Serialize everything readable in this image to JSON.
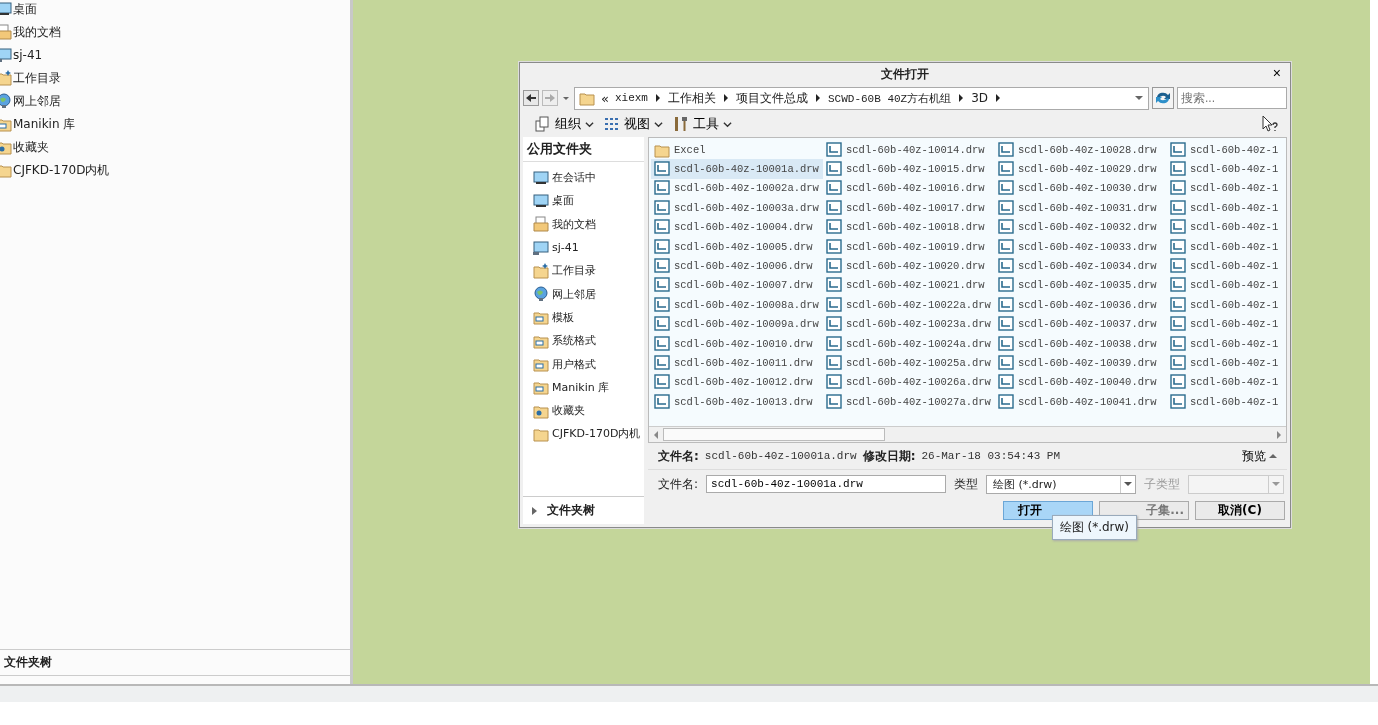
{
  "left_panel": {
    "items": [
      {
        "label": "桌面",
        "kind": "monitor"
      },
      {
        "label": "我的文档",
        "kind": "documents"
      },
      {
        "label": "sj-41",
        "kind": "computer"
      },
      {
        "label": "工作目录",
        "kind": "workdir"
      },
      {
        "label": "网上邻居",
        "kind": "network"
      },
      {
        "label": "Manikin 库",
        "kind": "library"
      },
      {
        "label": "收藏夹",
        "kind": "favorites"
      },
      {
        "label": "CJFKD-170D内机",
        "kind": "folder"
      }
    ],
    "footer": "文件夹树"
  },
  "dialog": {
    "title": "文件打开",
    "close": "×",
    "address": {
      "overflow": "«",
      "crumbs": [
        "xiexm",
        "工作相关",
        "项目文件总成",
        "SCWD-60B 40Z方右机组",
        "3D"
      ]
    },
    "search": {
      "placeholder": "搜索..."
    },
    "toolbar": [
      {
        "label": "组织",
        "kind": "organize"
      },
      {
        "label": "视图",
        "kind": "view"
      },
      {
        "label": "工具",
        "kind": "tools"
      }
    ],
    "sidebar": {
      "header": "公用文件夹",
      "items": [
        {
          "label": "在会话中",
          "kind": "monitor"
        },
        {
          "label": "桌面",
          "kind": "monitor"
        },
        {
          "label": "我的文档",
          "kind": "documents"
        },
        {
          "label": "sj-41",
          "kind": "computer"
        },
        {
          "label": "工作目录",
          "kind": "workdir"
        },
        {
          "label": "网上邻居",
          "kind": "network"
        },
        {
          "label": "模板",
          "kind": "library"
        },
        {
          "label": "系统格式",
          "kind": "library"
        },
        {
          "label": "用户格式",
          "kind": "library"
        },
        {
          "label": "Manikin 库",
          "kind": "library"
        },
        {
          "label": "收藏夹",
          "kind": "favorites"
        },
        {
          "label": "CJFKD-170D内机",
          "kind": "folder"
        }
      ],
      "footer": "文件夹树"
    },
    "files": [
      {
        "name": "Excel",
        "kind": "folder",
        "selected": false
      },
      {
        "name": "scdl-60b-40z-10001a.drw",
        "kind": "drawing",
        "selected": true
      },
      {
        "name": "scdl-60b-40z-10002a.drw",
        "kind": "drawing",
        "selected": false
      },
      {
        "name": "scdl-60b-40z-10003a.drw",
        "kind": "drawing",
        "selected": false
      },
      {
        "name": "scdl-60b-40z-10004.drw",
        "kind": "drawing",
        "selected": false
      },
      {
        "name": "scdl-60b-40z-10005.drw",
        "kind": "drawing",
        "selected": false
      },
      {
        "name": "scdl-60b-40z-10006.drw",
        "kind": "drawing",
        "selected": false
      },
      {
        "name": "scdl-60b-40z-10007.drw",
        "kind": "drawing",
        "selected": false
      },
      {
        "name": "scdl-60b-40z-10008a.drw",
        "kind": "drawing",
        "selected": false
      },
      {
        "name": "scdl-60b-40z-10009a.drw",
        "kind": "drawing",
        "selected": false
      },
      {
        "name": "scdl-60b-40z-10010.drw",
        "kind": "drawing",
        "selected": false
      },
      {
        "name": "scdl-60b-40z-10011.drw",
        "kind": "drawing",
        "selected": false
      },
      {
        "name": "scdl-60b-40z-10012.drw",
        "kind": "drawing",
        "selected": false
      },
      {
        "name": "scdl-60b-40z-10013.drw",
        "kind": "drawing",
        "selected": false
      },
      {
        "name": "scdl-60b-40z-10014.drw",
        "kind": "drawing",
        "selected": false
      },
      {
        "name": "scdl-60b-40z-10015.drw",
        "kind": "drawing",
        "selected": false
      },
      {
        "name": "scdl-60b-40z-10016.drw",
        "kind": "drawing",
        "selected": false
      },
      {
        "name": "scdl-60b-40z-10017.drw",
        "kind": "drawing",
        "selected": false
      },
      {
        "name": "scdl-60b-40z-10018.drw",
        "kind": "drawing",
        "selected": false
      },
      {
        "name": "scdl-60b-40z-10019.drw",
        "kind": "drawing",
        "selected": false
      },
      {
        "name": "scdl-60b-40z-10020.drw",
        "kind": "drawing",
        "selected": false
      },
      {
        "name": "scdl-60b-40z-10021.drw",
        "kind": "drawing",
        "selected": false
      },
      {
        "name": "scdl-60b-40z-10022a.drw",
        "kind": "drawing",
        "selected": false
      },
      {
        "name": "scdl-60b-40z-10023a.drw",
        "kind": "drawing",
        "selected": false
      },
      {
        "name": "scdl-60b-40z-10024a.drw",
        "kind": "drawing",
        "selected": false
      },
      {
        "name": "scdl-60b-40z-10025a.drw",
        "kind": "drawing",
        "selected": false
      },
      {
        "name": "scdl-60b-40z-10026a.drw",
        "kind": "drawing",
        "selected": false
      },
      {
        "name": "scdl-60b-40z-10027a.drw",
        "kind": "drawing",
        "selected": false
      },
      {
        "name": "scdl-60b-40z-10028.drw",
        "kind": "drawing",
        "selected": false
      },
      {
        "name": "scdl-60b-40z-10029.drw",
        "kind": "drawing",
        "selected": false
      },
      {
        "name": "scdl-60b-40z-10030.drw",
        "kind": "drawing",
        "selected": false
      },
      {
        "name": "scdl-60b-40z-10031.drw",
        "kind": "drawing",
        "selected": false
      },
      {
        "name": "scdl-60b-40z-10032.drw",
        "kind": "drawing",
        "selected": false
      },
      {
        "name": "scdl-60b-40z-10033.drw",
        "kind": "drawing",
        "selected": false
      },
      {
        "name": "scdl-60b-40z-10034.drw",
        "kind": "drawing",
        "selected": false
      },
      {
        "name": "scdl-60b-40z-10035.drw",
        "kind": "drawing",
        "selected": false
      },
      {
        "name": "scdl-60b-40z-10036.drw",
        "kind": "drawing",
        "selected": false
      },
      {
        "name": "scdl-60b-40z-10037.drw",
        "kind": "drawing",
        "selected": false
      },
      {
        "name": "scdl-60b-40z-10038.drw",
        "kind": "drawing",
        "selected": false
      },
      {
        "name": "scdl-60b-40z-10039.drw",
        "kind": "drawing",
        "selected": false
      },
      {
        "name": "scdl-60b-40z-10040.drw",
        "kind": "drawing",
        "selected": false
      },
      {
        "name": "scdl-60b-40z-10041.drw",
        "kind": "drawing",
        "selected": false
      },
      {
        "name": "scdl-60b-40z-1",
        "kind": "drawing",
        "selected": false
      },
      {
        "name": "scdl-60b-40z-1",
        "kind": "drawing",
        "selected": false
      },
      {
        "name": "scdl-60b-40z-1",
        "kind": "drawing",
        "selected": false
      },
      {
        "name": "scdl-60b-40z-1",
        "kind": "drawing",
        "selected": false
      },
      {
        "name": "scdl-60b-40z-1",
        "kind": "drawing",
        "selected": false
      },
      {
        "name": "scdl-60b-40z-1",
        "kind": "drawing",
        "selected": false
      },
      {
        "name": "scdl-60b-40z-1",
        "kind": "drawing",
        "selected": false
      },
      {
        "name": "scdl-60b-40z-1",
        "kind": "drawing",
        "selected": false
      },
      {
        "name": "scdl-60b-40z-1",
        "kind": "drawing",
        "selected": false
      },
      {
        "name": "scdl-60b-40z-1",
        "kind": "drawing",
        "selected": false
      },
      {
        "name": "scdl-60b-40z-1",
        "kind": "drawing",
        "selected": false
      },
      {
        "name": "scdl-60b-40z-1",
        "kind": "drawing",
        "selected": false
      },
      {
        "name": "scdl-60b-40z-1",
        "kind": "drawing",
        "selected": false
      },
      {
        "name": "scdl-60b-40z-1",
        "kind": "drawing",
        "selected": false
      }
    ],
    "info": {
      "name_label": "文件名:",
      "name_value": "scdl-60b-40z-10001a.drw",
      "date_label": "修改日期:",
      "date_value": "26-Mar-18 03:54:43 PM",
      "preview": "预览"
    },
    "filename_field": {
      "label": "文件名:",
      "value": "scdl-60b-40z-10001a.drw"
    },
    "type": {
      "label": "类型",
      "value": "绘图 (*.drw)"
    },
    "subtype": {
      "label": "子类型",
      "disabled": true
    },
    "buttons": [
      {
        "label": "打开",
        "kind": "primary"
      },
      {
        "label": "子集...",
        "kind": "normal"
      },
      {
        "label": "取消(C)",
        "kind": "normal"
      }
    ],
    "tooltip": "绘图 (*.drw)"
  }
}
